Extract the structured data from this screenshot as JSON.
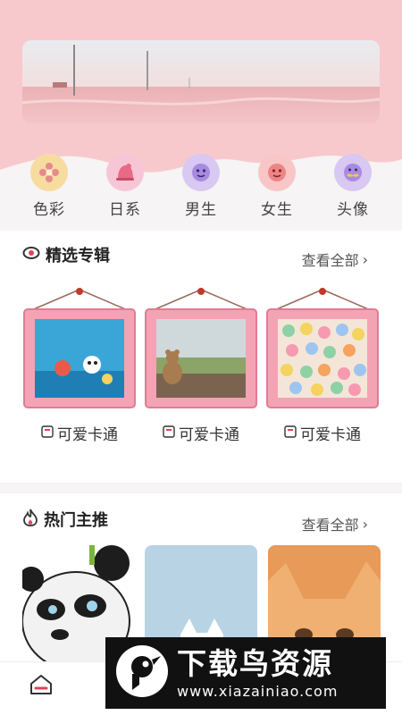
{
  "categories": [
    {
      "label": "色彩",
      "icon": "flower-icon",
      "color": "#f7dca0"
    },
    {
      "label": "日系",
      "icon": "hat-icon",
      "color": "#f7c6d6"
    },
    {
      "label": "男生",
      "icon": "boy-face-icon",
      "color": "#d8c8f2"
    },
    {
      "label": "女生",
      "icon": "girl-face-icon",
      "color": "#f8c6c6"
    },
    {
      "label": "头像",
      "icon": "mustache-face-icon",
      "color": "#d8c8f2"
    }
  ],
  "featured": {
    "title": "精选专辑",
    "more": "查看全部",
    "albums": [
      {
        "label": "可爱卡通",
        "image": "underwater-cartoon"
      },
      {
        "label": "可爱卡通",
        "image": "teddy-bear-window"
      },
      {
        "label": "可爱卡通",
        "image": "colorful-gummies"
      }
    ]
  },
  "hot": {
    "title": "热门主推",
    "more": "查看全部",
    "cards": [
      "panda-cartoon",
      "cat-blue-background",
      "orange-kitten"
    ]
  },
  "watermark": {
    "title": "下载鸟资源",
    "url": "www.xiazainiao.com"
  },
  "colors": {
    "header_pink": "#f8c9cc",
    "frame_pink": "#f4a3b4"
  }
}
